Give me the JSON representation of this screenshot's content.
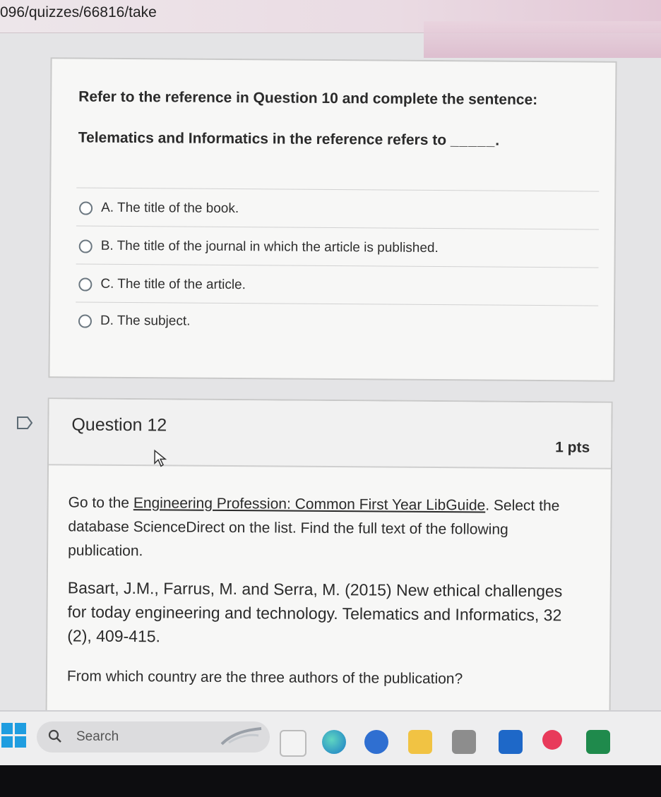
{
  "browser": {
    "url": "096/quizzes/66816/take"
  },
  "question11": {
    "prompt_line1": "Refer to the reference in Question 10 and complete the sentence:",
    "prompt_line2": "Telematics and Informatics in the reference refers to",
    "blank": "_____.",
    "options": [
      {
        "label": "A. The title of the book."
      },
      {
        "label": "B. The title of the journal in which the article is published."
      },
      {
        "label": "C. The title of the article."
      },
      {
        "label": "D. The subject."
      }
    ]
  },
  "question12": {
    "title": "Question 12",
    "points": "1 pts",
    "para1_prefix": "Go to the ",
    "para1_link": "Engineering Profession: Common First Year LibGuide",
    "para1_suffix": ". Select the database ScienceDirect on the list. Find the full text of the following publication.",
    "reference": "Basart, J.M., Farrus, M. and Serra, M. (2015) New ethical challenges for today engineering and technology. Telematics and Informatics, 32 (2), 409-415.",
    "question": "From which country are the three authors of the publication?"
  },
  "taskbar": {
    "search_label": "Search",
    "icons": [
      "windows-start-icon",
      "search-icon",
      "widget-icon",
      "file-icon",
      "edge-browser-icon",
      "app-icon",
      "file-explorer-icon",
      "calculator-icon",
      "outlook-icon",
      "media-player-icon",
      "excel-icon"
    ]
  }
}
